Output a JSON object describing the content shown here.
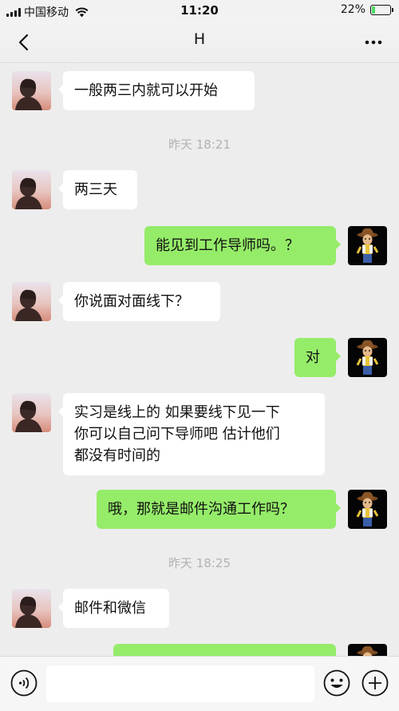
{
  "status_bar": {
    "carrier": "中国移动",
    "time": "11:20",
    "battery": "22%",
    "battery_level": 0.22,
    "icons": [
      "signal-icon",
      "wifi-icon",
      "battery-icon"
    ]
  },
  "nav": {
    "title": "H",
    "icons": [
      "back-arrow-icon",
      "more-icon"
    ]
  },
  "messages": [
    {
      "side": "left",
      "text": "一般两三内就可以开始"
    },
    {
      "side": "right",
      "text": "能见到工作导师吗。？"
    },
    {
      "side": "left",
      "text": "两三天"
    },
    {
      "side": "left",
      "text": "你说面对面线下？"
    },
    {
      "side": "right",
      "text": "对"
    },
    {
      "side": "left",
      "text": "实习是线上的 如果要线下见一下\n你可以自己问下导师吧 估计他们\n都没有时间的"
    },
    {
      "side": "right",
      "text": "哦，那就是邮件沟通工作吗？"
    },
    {
      "side": "left",
      "text": "邮件和微信"
    }
  ],
  "time_separators": [
    "昨天 18:21",
    "昨天 18:25"
  ],
  "input_bar": {
    "placeholder": "",
    "icons": [
      "voice-icon",
      "emoji-icon",
      "plus-icon"
    ]
  },
  "colors": {
    "background": "#ededed",
    "bubble_self": "#95ec69",
    "bubble_other": "#ffffff",
    "timestamp": "#b2b2b2",
    "battery_fill": "#4cd964"
  }
}
